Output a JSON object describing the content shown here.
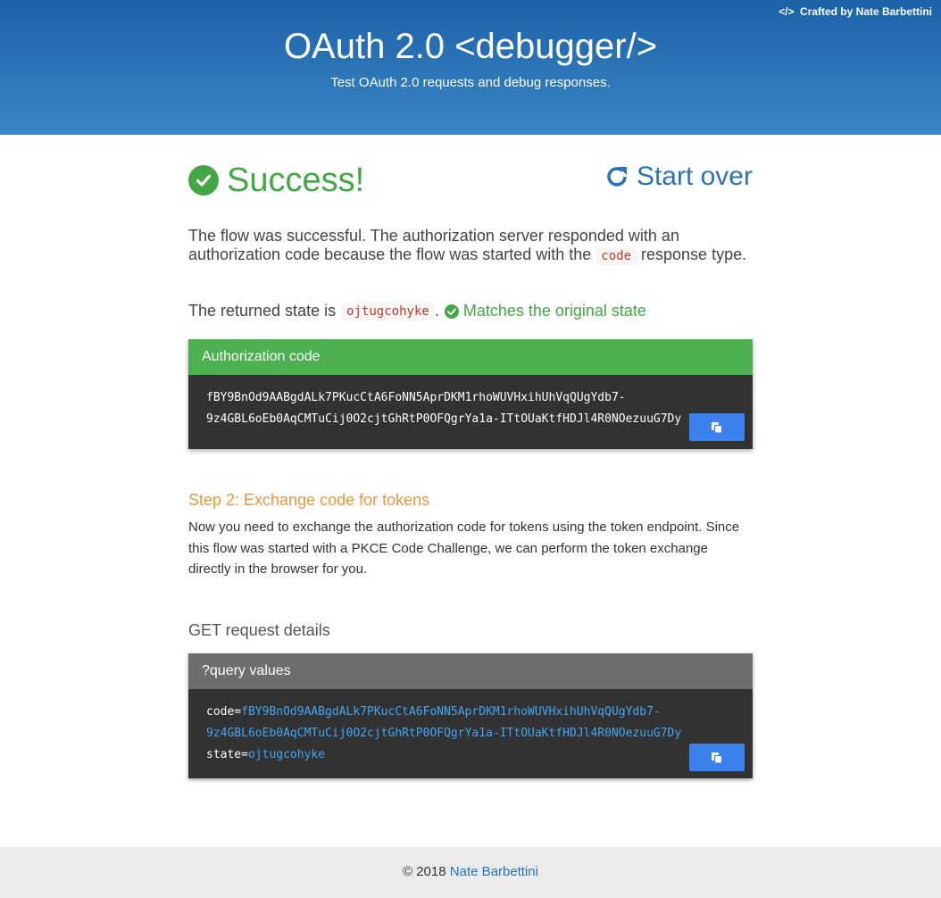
{
  "header": {
    "crafted_prefix": "</>",
    "crafted_by": "Crafted by Nate Barbettini",
    "title_main": "OAuth 2.0",
    "title_code": "<debugger/>",
    "subtitle": "Test OAuth 2.0 requests and debug responses."
  },
  "result": {
    "success_label": "Success!",
    "start_over_label": "Start over",
    "lead_part1": "The flow was successful. The authorization server responded with an authorization code because the flow was started with the",
    "lead_code": "code",
    "lead_part2": "response type.",
    "state_prefix": "The returned state is",
    "state_value": "ojtugcohyke",
    "state_dot": ".",
    "state_match": "Matches the original state"
  },
  "auth_code_card": {
    "title": "Authorization code",
    "line1": "fBY9BnOd9AABgdALk7PKucCtA6FoNN5AprDKM1rhoWUVHxihUhVqQUgYdb7-",
    "line2": "9z4GBL6oEb0AqCMTuCij0O2cjtGhRtP0OFQgrYa1a-ITtOUaKtfHDJl4R0NOezuuG7Dy"
  },
  "step2": {
    "title": "Step 2: Exchange code for tokens",
    "text": "Now you need to exchange the authorization code for tokens using the token endpoint. Since this flow was started with a PKCE Code Challenge, we can perform the token exchange directly in the browser for you."
  },
  "get_request": {
    "title": "GET request details",
    "card_title": "?query values",
    "code_key": "code=",
    "code_line1": "fBY9BnOd9AABgdALk7PKucCtA6FoNN5AprDKM1rhoWUVHxihUhVqQUgYdb7-",
    "code_line2": "9z4GBL6oEb0AqCMTuCij0O2cjtGhRtP0OFQgrYa1a-ITtOUaKtfHDJl4R0NOezuuG7Dy",
    "state_key": "state=",
    "state_value": "ojtugcohyke"
  },
  "footer": {
    "copyright": "© 2018",
    "author": "Nate Barbettini"
  },
  "colors": {
    "success": "#43a746",
    "accent": "#2a73b8",
    "step": "#e8973e",
    "copy_button": "#3b82ec"
  },
  "icons": {
    "success": "check-circle-icon",
    "start_over": "refresh-icon",
    "copy": "copy-icon",
    "match": "check-circle-icon"
  }
}
